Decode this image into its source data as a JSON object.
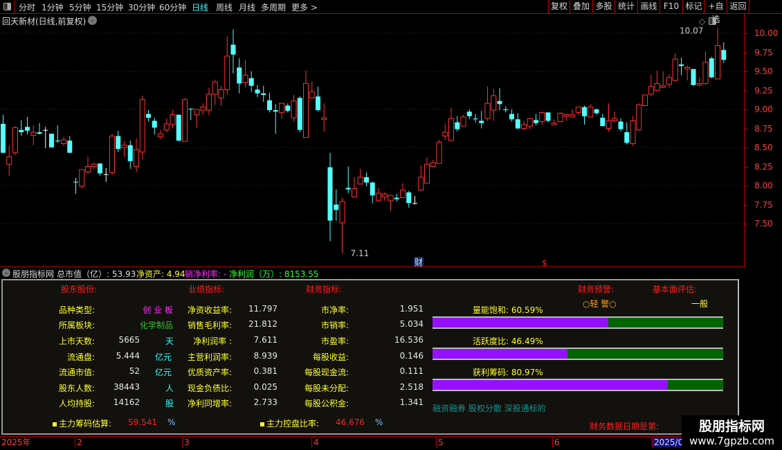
{
  "toolbar": {
    "periods": [
      "分时",
      "1分钟",
      "5分钟",
      "15分钟",
      "30分钟",
      "60分钟",
      "日线",
      "周线",
      "月线",
      "多周期",
      "更多 >"
    ],
    "active_period": "日线",
    "buttons": [
      "复权",
      "叠加",
      "多股",
      "统计",
      "画线",
      "F10",
      "标记",
      "+自选",
      "返回"
    ]
  },
  "chart_title": "回天新材(日线,前复权)",
  "price_axis": [
    "10.00",
    "9.75",
    "9.50",
    "9.25",
    "9.00",
    "8.75",
    "8.50",
    "8.25",
    "8.00",
    "7.75",
    "7.50"
  ],
  "markers": {
    "high_label": "10.07",
    "low_label": "7.11",
    "finance_badge": "财",
    "dollar_badge": "$"
  },
  "colors": {
    "up": "#ff3232",
    "down": "#54ffff",
    "flat": "#ffffff",
    "axis": "#ff3c3c",
    "bar_fill": "#9410ff",
    "bar_rest": "#006400"
  },
  "chart_data": {
    "type": "candlestick",
    "ylim": [
      7.5,
      10.0
    ],
    "ohlc": [
      [
        8.81,
        8.93,
        8.43,
        8.43
      ],
      [
        8.28,
        8.52,
        8.13,
        8.38
      ],
      [
        8.43,
        8.78,
        8.4,
        8.76
      ],
      [
        8.73,
        8.86,
        8.65,
        8.7
      ],
      [
        8.77,
        8.9,
        8.67,
        8.72
      ],
      [
        8.66,
        8.79,
        8.53,
        8.7
      ],
      [
        8.7,
        8.82,
        8.67,
        8.68
      ],
      [
        8.73,
        8.77,
        8.49,
        8.73
      ],
      [
        8.68,
        8.68,
        8.5,
        8.5
      ],
      [
        8.59,
        8.79,
        8.56,
        8.58
      ],
      [
        8.55,
        8.64,
        8.52,
        8.6
      ],
      [
        8.59,
        8.65,
        8.43,
        8.43
      ],
      [
        8.05,
        8.1,
        7.89,
        8.04
      ],
      [
        7.99,
        8.21,
        7.96,
        8.21
      ],
      [
        8.18,
        8.38,
        8.15,
        8.25
      ],
      [
        8.25,
        8.3,
        8.22,
        8.28
      ],
      [
        8.29,
        8.29,
        8.13,
        8.16
      ],
      [
        8.15,
        8.23,
        8.05,
        8.15
      ],
      [
        8.17,
        8.68,
        8.14,
        8.65
      ],
      [
        8.65,
        8.72,
        8.44,
        8.48
      ],
      [
        8.5,
        8.58,
        8.38,
        8.53
      ],
      [
        8.53,
        8.59,
        8.22,
        8.32
      ],
      [
        8.25,
        8.62,
        8.18,
        8.47
      ],
      [
        8.44,
        9.18,
        8.34,
        9.13
      ],
      [
        8.94,
        8.99,
        8.84,
        8.89
      ],
      [
        8.85,
        8.89,
        8.67,
        8.76
      ],
      [
        8.64,
        8.73,
        8.61,
        8.68
      ],
      [
        8.73,
        8.88,
        8.7,
        8.81
      ],
      [
        8.8,
        8.99,
        8.75,
        8.93
      ],
      [
        8.93,
        8.93,
        8.58,
        8.59
      ],
      [
        8.58,
        9.15,
        8.58,
        9.13
      ],
      [
        9.01,
        9.01,
        8.86,
        9.0
      ],
      [
        8.93,
        9.0,
        8.76,
        9.0
      ],
      [
        8.99,
        9.08,
        8.93,
        9.03
      ],
      [
        8.99,
        9.28,
        8.92,
        9.2
      ],
      [
        9.2,
        9.39,
        9.06,
        9.36
      ],
      [
        9.15,
        9.31,
        9.05,
        9.26
      ],
      [
        9.26,
        9.96,
        9.19,
        9.7
      ],
      [
        9.85,
        10.05,
        9.47,
        9.72
      ],
      [
        9.55,
        9.67,
        9.21,
        9.34
      ],
      [
        9.35,
        9.65,
        9.29,
        9.45
      ],
      [
        9.41,
        9.5,
        9.23,
        9.31
      ],
      [
        9.26,
        9.32,
        9.16,
        9.21
      ],
      [
        9.21,
        9.31,
        9.1,
        9.19
      ],
      [
        9.12,
        9.22,
        8.96,
        8.99
      ],
      [
        8.99,
        9.07,
        8.68,
        8.97
      ],
      [
        8.96,
        9.08,
        8.88,
        9.08
      ],
      [
        9.05,
        9.08,
        8.96,
        8.98
      ],
      [
        8.89,
        9.19,
        8.84,
        9.11
      ],
      [
        9.15,
        9.17,
        8.7,
        8.73
      ],
      [
        8.63,
        9.51,
        8.63,
        9.34
      ],
      [
        9.15,
        9.37,
        9.14,
        9.23
      ],
      [
        9.17,
        9.3,
        8.97,
        8.99
      ],
      [
        8.87,
        9.08,
        8.71,
        8.89
      ],
      [
        8.24,
        8.43,
        7.27,
        7.54
      ],
      [
        7.75,
        7.95,
        7.54,
        7.68
      ],
      [
        7.51,
        7.84,
        7.11,
        7.79
      ],
      [
        7.97,
        8.25,
        7.9,
        7.95
      ],
      [
        7.85,
        8.11,
        7.85,
        7.96
      ],
      [
        8.02,
        8.22,
        8.02,
        8.11
      ],
      [
        8.11,
        8.17,
        7.99,
        8.04
      ],
      [
        8.04,
        8.05,
        7.77,
        7.87
      ],
      [
        7.8,
        7.97,
        7.79,
        7.9
      ],
      [
        7.85,
        7.91,
        7.8,
        7.89
      ],
      [
        7.8,
        7.88,
        7.67,
        7.87
      ],
      [
        7.84,
        7.89,
        7.79,
        7.82
      ],
      [
        7.84,
        8.03,
        7.84,
        7.94
      ],
      [
        7.91,
        7.93,
        7.71,
        7.77
      ],
      [
        7.77,
        7.86,
        7.75,
        7.77
      ],
      [
        7.94,
        8.27,
        7.93,
        8.11
      ],
      [
        8.03,
        8.37,
        8.03,
        8.28
      ],
      [
        8.25,
        8.34,
        8.24,
        8.3
      ],
      [
        8.29,
        8.6,
        8.29,
        8.57
      ],
      [
        8.65,
        8.81,
        8.6,
        8.7
      ],
      [
        8.59,
        9.02,
        8.59,
        8.88
      ],
      [
        8.83,
        8.91,
        8.71,
        8.74
      ],
      [
        8.78,
        8.93,
        8.78,
        8.9
      ],
      [
        8.97,
        9.0,
        8.87,
        8.91
      ],
      [
        8.88,
        8.94,
        8.83,
        8.87
      ],
      [
        8.85,
        8.98,
        8.75,
        8.82
      ],
      [
        8.88,
        9.3,
        8.85,
        9.08
      ],
      [
        8.99,
        9.27,
        8.85,
        9.18
      ],
      [
        9.11,
        9.28,
        8.99,
        9.07
      ],
      [
        9.0,
        9.04,
        8.96,
        8.99
      ],
      [
        8.94,
        9.0,
        8.84,
        8.87
      ],
      [
        8.87,
        8.95,
        8.74,
        8.75
      ],
      [
        8.75,
        8.85,
        8.73,
        8.8
      ],
      [
        8.78,
        8.89,
        8.74,
        8.88
      ],
      [
        8.86,
        8.94,
        8.79,
        8.82
      ],
      [
        8.84,
        8.97,
        8.8,
        8.96
      ],
      [
        8.96,
        8.96,
        8.83,
        8.85
      ],
      [
        8.8,
        8.87,
        8.8,
        8.82
      ],
      [
        8.84,
        8.96,
        8.83,
        8.95
      ],
      [
        8.91,
        8.94,
        8.85,
        8.93
      ],
      [
        8.9,
        9.0,
        8.89,
        8.93
      ],
      [
        8.96,
        9.03,
        8.93,
        9.03
      ],
      [
        9.03,
        9.05,
        8.8,
        8.91
      ],
      [
        8.9,
        9.07,
        8.9,
        9.03
      ],
      [
        9.0,
        9.01,
        8.93,
        8.95
      ],
      [
        8.89,
        8.94,
        8.78,
        8.78
      ],
      [
        8.75,
        9.08,
        8.71,
        8.85
      ],
      [
        8.85,
        8.97,
        8.83,
        8.88
      ],
      [
        8.84,
        8.88,
        8.71,
        8.74
      ],
      [
        8.7,
        8.83,
        8.54,
        8.56
      ],
      [
        8.55,
        8.91,
        8.52,
        8.85
      ],
      [
        8.73,
        9.08,
        8.72,
        9.06
      ],
      [
        9.05,
        9.19,
        9.05,
        9.19
      ],
      [
        9.2,
        9.46,
        9.18,
        9.3
      ],
      [
        9.25,
        9.51,
        9.24,
        9.34
      ],
      [
        9.29,
        9.5,
        9.28,
        9.31
      ],
      [
        9.33,
        9.46,
        9.28,
        9.42
      ],
      [
        9.38,
        9.74,
        9.37,
        9.66
      ],
      [
        9.59,
        9.68,
        9.45,
        9.57
      ],
      [
        9.53,
        9.58,
        9.38,
        9.55
      ],
      [
        9.53,
        9.53,
        9.31,
        9.32
      ],
      [
        9.32,
        9.42,
        9.3,
        9.34
      ],
      [
        9.34,
        9.76,
        9.32,
        9.62
      ],
      [
        9.67,
        9.69,
        9.41,
        9.42
      ],
      [
        9.4,
        10.07,
        9.4,
        9.84
      ],
      [
        9.78,
        9.88,
        9.61,
        9.65
      ]
    ],
    "date_labels": [
      "2025年",
      "2",
      "3",
      "4",
      "5",
      "6",
      "2025/0"
    ]
  },
  "indicator_header": {
    "name": "股朋指标网",
    "mktcap": "总市值（亿）: 53.93",
    "net_assets": "净资产: 4.94",
    "net_margin": "销净利率: -",
    "net_profit": "净利润（万）: 8153.55"
  },
  "panel": {
    "headings": {
      "holders": "股东股份:",
      "performance": "业绩指标:",
      "finance": "财务指标:",
      "warning": "财务预警:",
      "fundamental": "基本面评估:"
    },
    "warning_value": "○轻 警○",
    "fundamental_value": "一般",
    "holders": [
      {
        "label": "品种类型:",
        "value": "创 业 板",
        "unit": ""
      },
      {
        "label": "所属板块:",
        "value": "化学制品",
        "unit": ""
      },
      {
        "label": "上市天数:",
        "value": "5665",
        "unit": "天"
      },
      {
        "label": "流通盘:",
        "value": "5.444",
        "unit": "亿元"
      },
      {
        "label": "流通市值:",
        "value": "52",
        "unit": "亿元"
      },
      {
        "label": "股东人数:",
        "value": "38443",
        "unit": "人"
      },
      {
        "label": "人均持股:",
        "value": "14162",
        "unit": "股"
      }
    ],
    "performance": [
      {
        "label": "净资收益率:",
        "value": "11.797"
      },
      {
        "label": "销售毛利率:",
        "value": "21.812"
      },
      {
        "label": "净利润率 :",
        "value": "7.611"
      },
      {
        "label": "主营利润率:",
        "value": "8.939"
      },
      {
        "label": "优质资产率:",
        "value": "0.381"
      },
      {
        "label": "现金负债比:",
        "value": "0.025"
      },
      {
        "label": "净利同增率:",
        "value": "2.733"
      }
    ],
    "finance": [
      {
        "label": "市净率:",
        "value": "1.951"
      },
      {
        "label": "市销率:",
        "value": "5.034"
      },
      {
        "label": "市盈率:",
        "value": "16.536"
      },
      {
        "label": "每股收益:",
        "value": "0.146"
      },
      {
        "label": "每股现金流:",
        "value": "0.111"
      },
      {
        "label": "每股未分配:",
        "value": "2.518"
      },
      {
        "label": "每股公积金:",
        "value": "1.341"
      }
    ],
    "gauges": [
      {
        "label": "量能饱和:",
        "text": "60.59%",
        "percent": 60.59
      },
      {
        "label": "活跃度比:",
        "text": "46.49%",
        "percent": 46.49
      },
      {
        "label": "获利筹码:",
        "text": "80.97%",
        "percent": 80.97
      }
    ],
    "tags": "融资融券 股权分散 深股通标的",
    "chips_label": "主力筹码估算:",
    "chips_value": "59.541",
    "control_label": "主力控盘比率:",
    "control_value": "46.676",
    "pct": "%",
    "fin_date_label": "财务数据日期是第:"
  },
  "watermark": {
    "name": "股朋指标网",
    "url": "www.7gpzb.com"
  }
}
